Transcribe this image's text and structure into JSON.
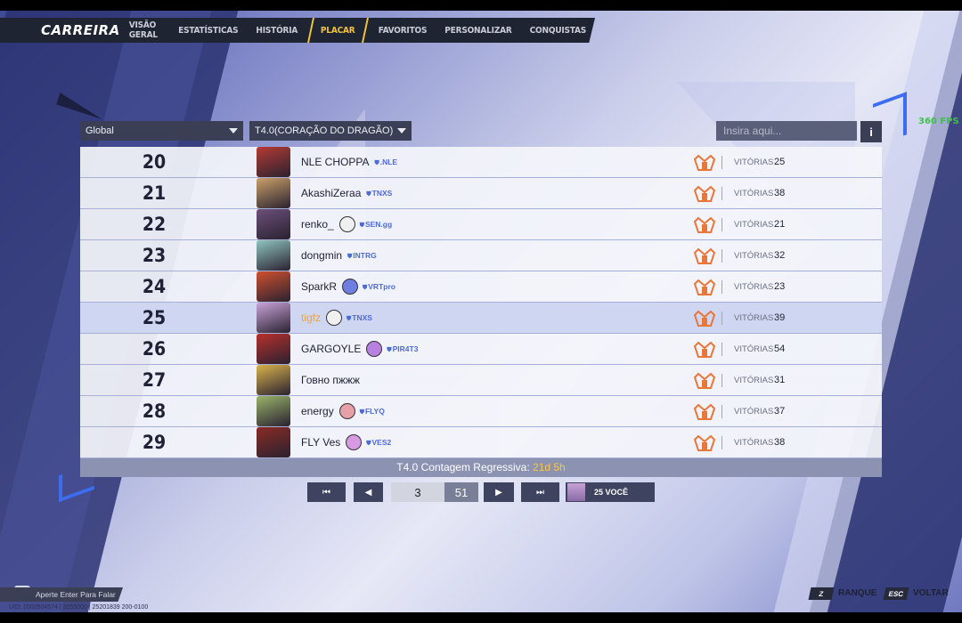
{
  "nav": {
    "brand": "CARREIRA",
    "tabs": [
      {
        "label": "VISÃO GERAL",
        "active": false
      },
      {
        "label": "ESTATÍSTICAS",
        "active": false
      },
      {
        "label": "HISTÓRIA",
        "active": false
      },
      {
        "label": "PLACAR",
        "active": true
      },
      {
        "label": "FAVORITOS",
        "active": false
      },
      {
        "label": "PERSONALIZAR",
        "active": false
      },
      {
        "label": "CONQUISTAS",
        "active": false
      }
    ]
  },
  "fps": "360 FPS",
  "filters": {
    "region": "Global",
    "season": "T4.0(CORAÇÃO DO DRAGÃO)",
    "search_placeholder": "Insira aqui...",
    "info_label": "i"
  },
  "leaderboard": {
    "rows": [
      {
        "rank": "20",
        "name": "NLE CHOPPA",
        "tag": ".NLE",
        "badge": "",
        "wins_label": "VITÓRIAS",
        "wins": "25",
        "me": false,
        "portrait_color": "#b53a34"
      },
      {
        "rank": "21",
        "name": "AkashiZeraa",
        "tag": "TNXS",
        "badge": "",
        "wins_label": "VITÓRIAS",
        "wins": "38",
        "me": false,
        "portrait_color": "#caa06a"
      },
      {
        "rank": "22",
        "name": "renko_",
        "tag": "SEN.gg",
        "badge": "#f0f0f0",
        "wins_label": "VITÓRIAS",
        "wins": "21",
        "me": false,
        "portrait_color": "#6b4f7a"
      },
      {
        "rank": "23",
        "name": "dongmin",
        "tag": "INTRG",
        "badge": "",
        "wins_label": "VITÓRIAS",
        "wins": "32",
        "me": false,
        "portrait_color": "#8fc4c0"
      },
      {
        "rank": "24",
        "name": "SparkR",
        "tag": "VRTpro",
        "badge": "#6f7fe0",
        "wins_label": "VITÓRIAS",
        "wins": "23",
        "me": false,
        "portrait_color": "#d0502f"
      },
      {
        "rank": "25",
        "name": "tigfz",
        "tag": "TNXS",
        "badge": "#f0f0f0",
        "wins_label": "VITÓRIAS",
        "wins": "39",
        "me": true,
        "portrait_color": "#c9a3da"
      },
      {
        "rank": "26",
        "name": "GARGOYLE",
        "tag": "PIR4T3",
        "badge": "#b880e0",
        "wins_label": "VITÓRIAS",
        "wins": "54",
        "me": false,
        "portrait_color": "#b8302c"
      },
      {
        "rank": "27",
        "name": "Говно пжжж",
        "tag": "",
        "badge": "",
        "wins_label": "VITÓRIAS",
        "wins": "31",
        "me": false,
        "portrait_color": "#d9b34c"
      },
      {
        "rank": "28",
        "name": "energy",
        "tag": "FLYQ",
        "badge": "#e8a0a8",
        "wins_label": "VITÓRIAS",
        "wins": "37",
        "me": false,
        "portrait_color": "#9ab36a"
      },
      {
        "rank": "29",
        "name": "FLY Ves",
        "tag": "VES2",
        "badge": "#d59ae0",
        "wins_label": "VITÓRIAS",
        "wins": "38",
        "me": false,
        "portrait_color": "#8a2b24"
      }
    ],
    "countdown_label": "T4.0 Contagem Regressiva:",
    "countdown_time": "21d 5h"
  },
  "pagination": {
    "first": "⏮",
    "prev": "◀",
    "page": "3",
    "total": "51",
    "next": "▶",
    "last": "⏭",
    "me_label": "25 VOCÊ"
  },
  "footer": {
    "chat_label": "Aperte Enter Para Falar",
    "uid": "UID: 2000504574 | 3355000 | 25201839 200-0100",
    "key_z": "Z",
    "ranque": "RANQUE",
    "key_esc": "ESC",
    "voltar": "VOLTAR"
  },
  "colors": {
    "accent": "#f2c33a",
    "highlight_row": "#cfd6f2",
    "tag_blue": "#4d6ad6",
    "rank_icon": "#e8773a"
  }
}
